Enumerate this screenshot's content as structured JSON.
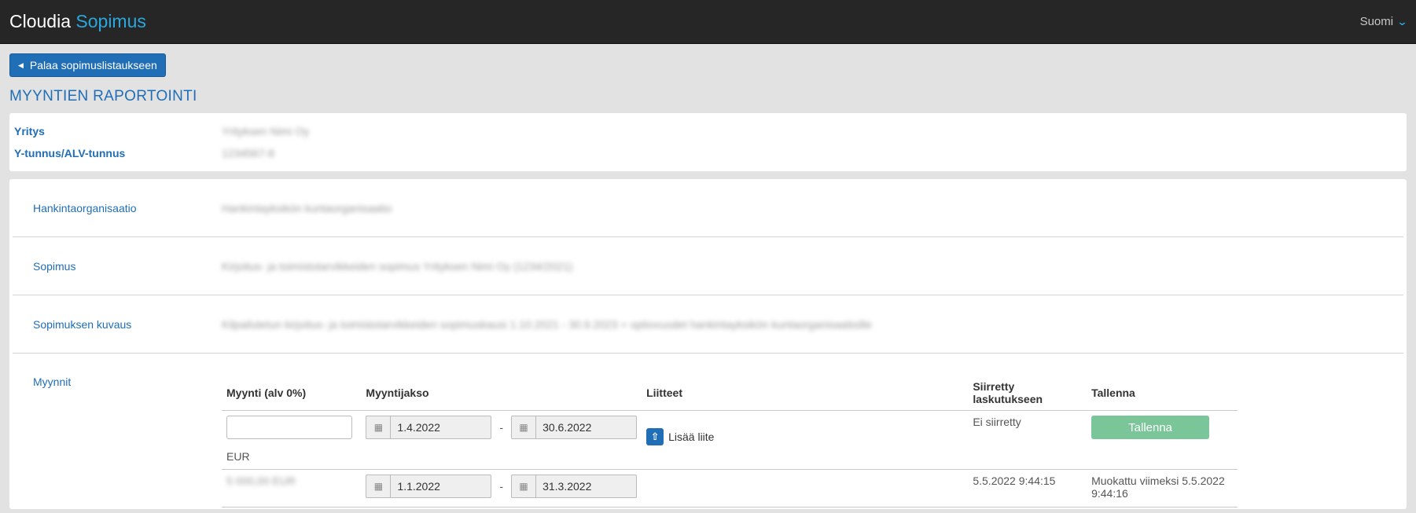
{
  "app": {
    "brand_main": "Cloudia",
    "brand_accent": "Sopimus",
    "language": "Suomi"
  },
  "nav": {
    "back_label": "Palaa sopimuslistaukseen"
  },
  "page_title": "MYYNTIEN RAPORTOINTI",
  "company": {
    "company_label": "Yritys",
    "company_value": "Yrityksen Nimi Oy",
    "id_label": "Y-tunnus/ALV-tunnus",
    "id_value": "1234567-8"
  },
  "details": {
    "org_label": "Hankintaorganisaatio",
    "org_value": "Hankintayksikön kuntaorganisaatio",
    "contract_label": "Sopimus",
    "contract_value": "Kirjoitus- ja toimistotarvikkeiden sopimus Yrityksen Nimi Oy (1234/2021)",
    "desc_label": "Sopimuksen kuvaus",
    "desc_value": "Kilpailutetun kirjoitus- ja toimistotarvikkeiden sopimuskausi 1.10.2021 - 30.9.2023 + optiovuodet hankintayksikön kuntaorganisaatioille"
  },
  "sales": {
    "label": "Myynnit",
    "headers": [
      "Myynti (alv 0%)",
      "Myyntijakso",
      "Liitteet",
      "Siirretty laskutukseen",
      "Tallenna"
    ],
    "rows": [
      {
        "amount": "",
        "currency": "EUR",
        "start": "1.4.2022",
        "end": "30.6.2022",
        "attach_label": "Lisää liite",
        "transferred": "Ei siirretty",
        "save_label": "Tallenna"
      },
      {
        "amount": "5 000,00 EUR",
        "start": "1.1.2022",
        "end": "31.3.2022",
        "transferred": "5.5.2022 9:44:15",
        "modified": "Muokattu viimeksi 5.5.2022 9:44:16"
      }
    ]
  },
  "colors": {
    "primary": "#1f6eb6",
    "accent": "#29a8e0",
    "save": "#6cc08f",
    "navbar": "#262626"
  }
}
